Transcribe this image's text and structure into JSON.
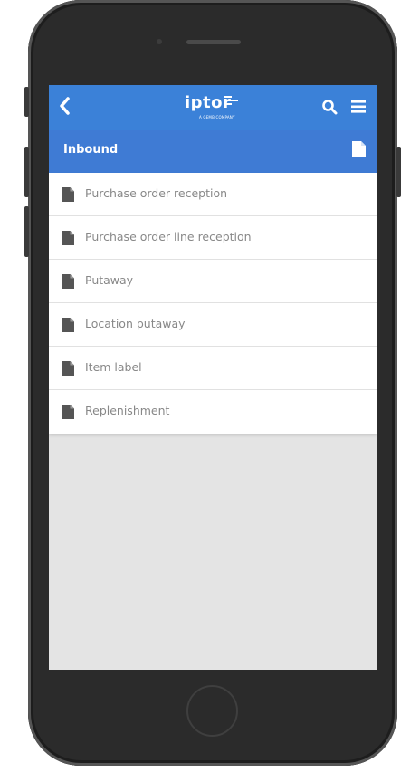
{
  "header": {
    "brand": "iptor",
    "brand_tagline": "A GEMB COMPANY",
    "back_icon": "chevron-left-icon",
    "search_icon": "search-icon",
    "menu_icon": "hamburger-menu-icon"
  },
  "section": {
    "title": "Inbound",
    "icon": "document-icon"
  },
  "list": {
    "items": [
      {
        "label": "Purchase order reception",
        "icon": "document-icon"
      },
      {
        "label": "Purchase order line reception",
        "icon": "document-icon"
      },
      {
        "label": "Putaway",
        "icon": "document-icon"
      },
      {
        "label": "Location putaway",
        "icon": "document-icon"
      },
      {
        "label": "Item label",
        "icon": "document-icon"
      },
      {
        "label": "Replenishment",
        "icon": "document-icon"
      }
    ]
  },
  "colors": {
    "topbar": "#3b81d8",
    "section": "#3f7bd4",
    "screen_bg": "#e4e4e4",
    "phone": "#2b2b2b"
  }
}
